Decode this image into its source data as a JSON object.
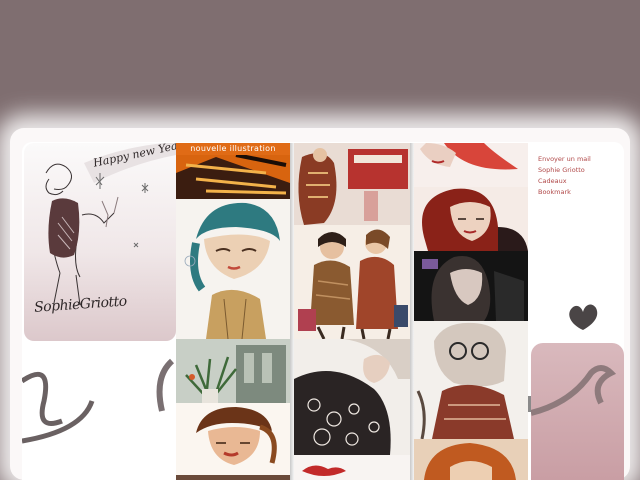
{
  "gallery": {
    "banner_label": "nouvelle illustration"
  },
  "profile": {
    "greeting": "Happy new Year!",
    "signature": "SophieGriotto"
  },
  "nav": {
    "items": [
      {
        "label": "Envoyer un mail"
      },
      {
        "label": "Sophie Griotto"
      },
      {
        "label": "Cadeaux"
      },
      {
        "label": "Bookmark"
      }
    ]
  },
  "colors": {
    "page_background": "#7f6e70",
    "frame": "#fbf8f8",
    "accent_orange": "#e06b16",
    "link_red": "#b04848",
    "card_pink": "#d9b9bd"
  }
}
